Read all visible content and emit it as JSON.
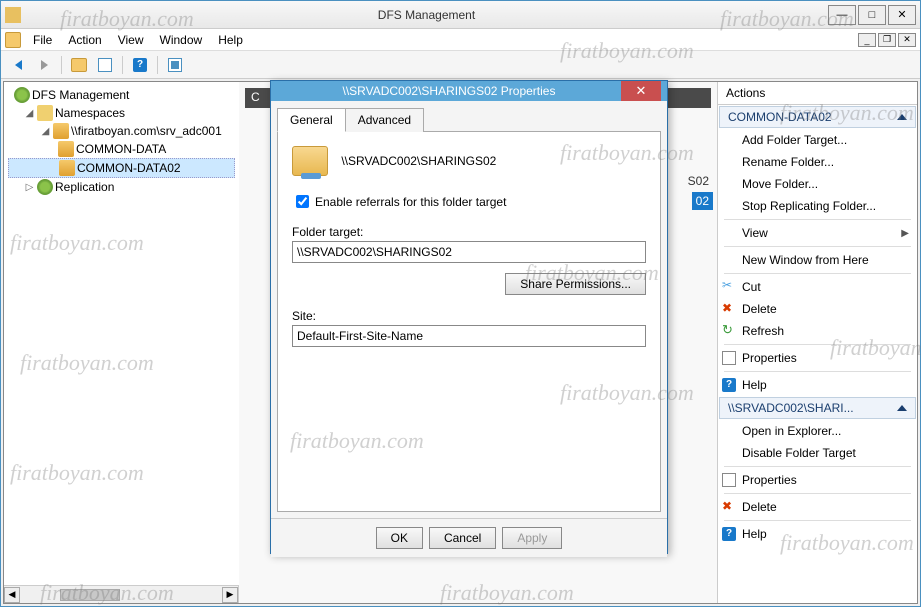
{
  "window": {
    "title": "DFS Management"
  },
  "menubar": [
    "File",
    "Action",
    "View",
    "Window",
    "Help"
  ],
  "tree": {
    "root": "DFS Management",
    "namespaces": "Namespaces",
    "ns_path": "\\\\firatboyan.com\\srv_adc001",
    "items": [
      "COMMON-DATA",
      "COMMON-DATA02"
    ],
    "replication": "Replication"
  },
  "actions": {
    "header": "Actions",
    "section1": "COMMON-DATA02",
    "group1": [
      "Add Folder Target...",
      "Rename Folder...",
      "Move Folder...",
      "Stop Replicating Folder..."
    ],
    "view": "View",
    "newwin": "New Window from Here",
    "cut": "Cut",
    "delete": "Delete",
    "refresh": "Refresh",
    "properties": "Properties",
    "help": "Help",
    "section2": "\\\\SRVADC002\\SHARI...",
    "group2": [
      "Open in Explorer...",
      "Disable Folder Target"
    ],
    "properties2": "Properties",
    "delete2": "Delete",
    "help2": "Help"
  },
  "dialog": {
    "title": "\\\\SRVADC002\\SHARINGS02 Properties",
    "tabs": [
      "General",
      "Advanced"
    ],
    "path": "\\\\SRVADC002\\SHARINGS02",
    "enable_referrals": "Enable referrals for this folder target",
    "folder_target_label": "Folder target:",
    "folder_target_value": "\\\\SRVADC002\\SHARINGS02",
    "share_perms": "Share Permissions...",
    "site_label": "Site:",
    "site_value": "Default-First-Site-Name",
    "ok": "OK",
    "cancel": "Cancel",
    "apply": "Apply"
  },
  "mid_fragments": {
    "f1": "S02",
    "f2": "02"
  },
  "watermark": "firatboyan.com"
}
